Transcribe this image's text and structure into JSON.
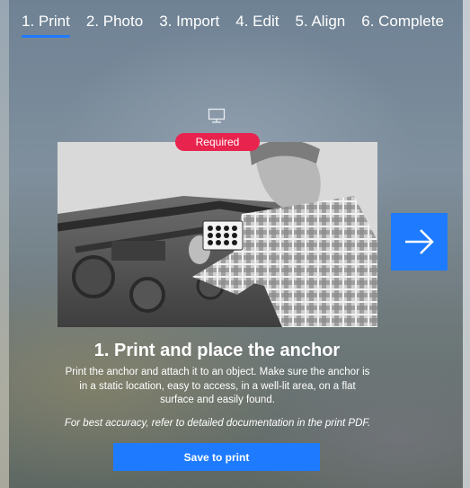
{
  "steps": [
    {
      "label": "1. Print",
      "active": true
    },
    {
      "label": "2. Photo"
    },
    {
      "label": "3. Import"
    },
    {
      "label": "4. Edit"
    },
    {
      "label": "5. Align"
    },
    {
      "label": "6. Complete"
    }
  ],
  "badge": {
    "label": "Required",
    "color": "#e8244e"
  },
  "accent_color": "#1e7bff",
  "icons": {
    "device": "monitor-icon",
    "next": "arrow-right-icon"
  },
  "main": {
    "title": "1. Print and place the anchor",
    "description": "Print the anchor and attach it to an object. Make sure the anchor is in a static location, easy to access, in a well-lit area, on a flat surface and easily found.",
    "note": "For best accuracy, refer to detailed documentation in the print PDF.",
    "save_label": "Save to print"
  }
}
